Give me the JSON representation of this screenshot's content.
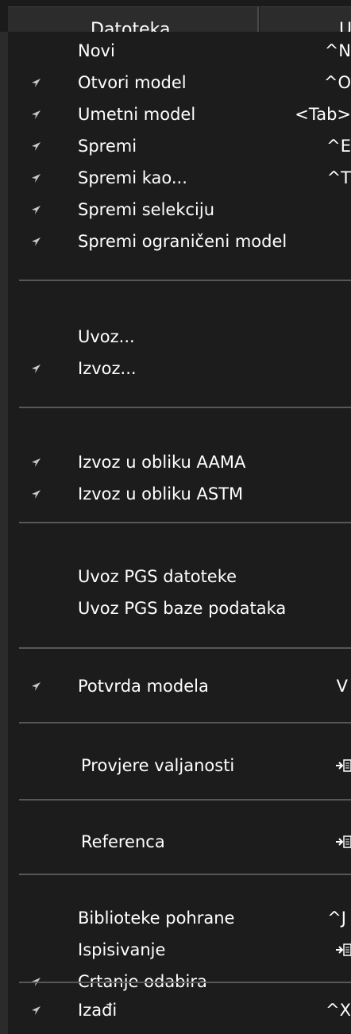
{
  "menubar": {
    "active_label": "Datoteka",
    "next_label": "U"
  },
  "menu": {
    "items": [
      {
        "label": "Novi",
        "shortcut": "^N",
        "bullet": false
      },
      {
        "label": "Otvori model",
        "shortcut": "^O",
        "bullet": true
      },
      {
        "label": "Umetni model",
        "shortcut": "<Tab>",
        "bullet": true
      },
      {
        "label": "Spremi",
        "shortcut": "^E",
        "bullet": true
      },
      {
        "label": "Spremi kao...",
        "shortcut": "^T",
        "bullet": true
      },
      {
        "label": "Spremi selekciju",
        "shortcut": "",
        "bullet": true
      },
      {
        "label": "Spremi ograničeni model",
        "shortcut": "",
        "bullet": true
      },
      {
        "label": "Uvoz...",
        "shortcut": "",
        "bullet": false
      },
      {
        "label": "Izvoz...",
        "shortcut": "",
        "bullet": true
      },
      {
        "label": "Izvoz u obliku AAMA",
        "shortcut": "",
        "bullet": true
      },
      {
        "label": "Izvoz u obliku ASTM",
        "shortcut": "",
        "bullet": true
      },
      {
        "label": "Uvoz PGS datoteke",
        "shortcut": "",
        "bullet": false
      },
      {
        "label": "Uvoz PGS baze podataka",
        "shortcut": "",
        "bullet": false
      },
      {
        "label": "Potvrda modela",
        "shortcut": "V",
        "bullet": true
      },
      {
        "label": "Provjere valjanosti",
        "shortcut": "",
        "bullet": false,
        "submenu": true
      },
      {
        "label": "Referenca",
        "shortcut": "",
        "bullet": false,
        "submenu": true
      },
      {
        "label": "Biblioteke pohrane",
        "shortcut": "^J",
        "bullet": false
      },
      {
        "label": "Ispisivanje",
        "shortcut": "",
        "bullet": false,
        "submenu": true
      },
      {
        "label": "Crtanje odabira",
        "shortcut": "",
        "bullet": true
      },
      {
        "label": "Izađi",
        "shortcut": "^X",
        "bullet": true
      }
    ]
  },
  "colors": {
    "background": "#1c1c1c",
    "text": "#ffffff",
    "separator": "#575757",
    "bullet": "#c8c8c8"
  }
}
